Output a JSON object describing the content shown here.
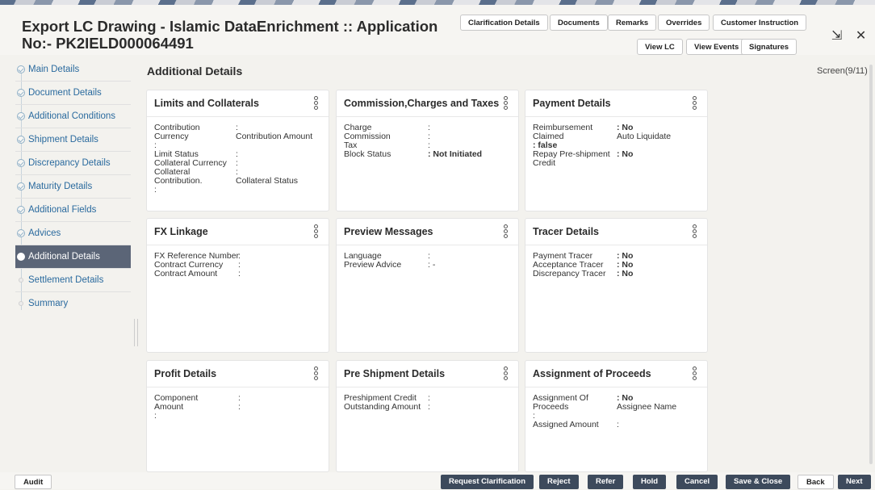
{
  "header": {
    "title_line1": "Export LC Drawing - Islamic DataEnrichment :: Application",
    "title_line2": "No:- PK2IELD000064491",
    "buttons_row1": [
      "Clarification Details",
      "Documents",
      "Remarks",
      "Overrides",
      "Customer Instruction"
    ],
    "buttons_row2": [
      "View LC",
      "View Events",
      "Signatures"
    ],
    "window_icons": [
      "collapse-icon",
      "close-icon"
    ],
    "window_glyphs": "⇲ ✕"
  },
  "sidebar": {
    "items": [
      {
        "label": "Main Details"
      },
      {
        "label": "Document Details"
      },
      {
        "label": "Additional Conditions"
      },
      {
        "label": "Shipment Details"
      },
      {
        "label": "Discrepancy Details"
      },
      {
        "label": "Maturity Details"
      },
      {
        "label": "Additional Fields"
      },
      {
        "label": "Advices"
      },
      {
        "label": "Additional Details"
      },
      {
        "label": "Settlement Details"
      },
      {
        "label": "Summary"
      }
    ]
  },
  "main": {
    "title": "Additional Details",
    "screen": "Screen(9/11)",
    "cards": {
      "limits": {
        "title": "Limits and Collaterals",
        "contribution": "Contribution",
        "currency": "Currency",
        "contribution_amount": "Contribution Amount",
        "limit_status": "Limit Status",
        "collateral_currency": "Collateral Currency",
        "collateral": "Collateral",
        "contribution_dot": "Contribution.",
        "collateral_status": "Collateral Status"
      },
      "commission": {
        "title": "Commission,Charges and Taxes",
        "charge": "Charge",
        "commission": "Commission",
        "tax": "Tax",
        "block_status": "Block Status",
        "block_status_value": ": Not Initiated"
      },
      "payment": {
        "title": "Payment Details",
        "reimbursement": "Reimbursement",
        "reimbursement_value": ": No",
        "claimed": "Claimed",
        "auto_liquidate": "Auto Liquidate",
        "claimed_value": ": false",
        "repay": "Repay Pre-shipment",
        "credit": "Credit",
        "repay_value": ": No"
      },
      "fx": {
        "title": "FX Linkage",
        "fx_ref": "FX Reference Number",
        "contract_currency": "Contract Currency",
        "contract_amount": "Contract Amount"
      },
      "preview": {
        "title": "Preview Messages",
        "language": "Language",
        "preview_advice": "Preview Advice",
        "preview_advice_value": ": -"
      },
      "tracer": {
        "title": "Tracer Details",
        "payment_tracer": "Payment Tracer",
        "payment_tracer_value": ": No",
        "acceptance_tracer": "Acceptance Tracer",
        "acceptance_tracer_value": ": No",
        "discrepancy_tracer": "Discrepancy Tracer",
        "discrepancy_tracer_value": ": No"
      },
      "profit": {
        "title": "Profit Details",
        "component": "Component",
        "amount": "Amount"
      },
      "preshipment": {
        "title": "Pre Shipment Details",
        "preshipment_credit": "Preshipment Credit",
        "outstanding_amount": "Outstanding Amount"
      },
      "assignment": {
        "title": "Assignment of Proceeds",
        "assignment_of": "Assignment Of",
        "assignment_value": ": No",
        "proceeds": "Proceeds",
        "assignee_name": "Assignee Name",
        "assigned_amount": "Assigned Amount"
      }
    }
  },
  "colon": ":",
  "footer": {
    "audit": "Audit",
    "request_clarification": "Request Clarification",
    "reject": "Reject",
    "refer": "Refer",
    "hold": "Hold",
    "cancel": "Cancel",
    "save_close": "Save & Close",
    "back": "Back",
    "next": "Next"
  }
}
